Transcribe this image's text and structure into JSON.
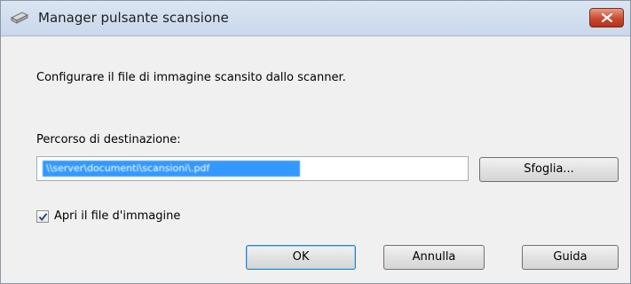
{
  "window": {
    "title": "Manager pulsante scansione",
    "icon": "scanner-icon"
  },
  "dialog": {
    "description": "Configurare il file di immagine scansito dallo scanner.",
    "destination_label": "Percorso di destinazione:",
    "destination_value": "\\\\server\\documenti\\scansioni\\.pdf",
    "browse_label": "Sfoglia...",
    "open_file_label": "Apri il file d'immagine",
    "open_file_checked": true,
    "ok_label": "OK",
    "cancel_label": "Annulla",
    "help_label": "Guida"
  }
}
